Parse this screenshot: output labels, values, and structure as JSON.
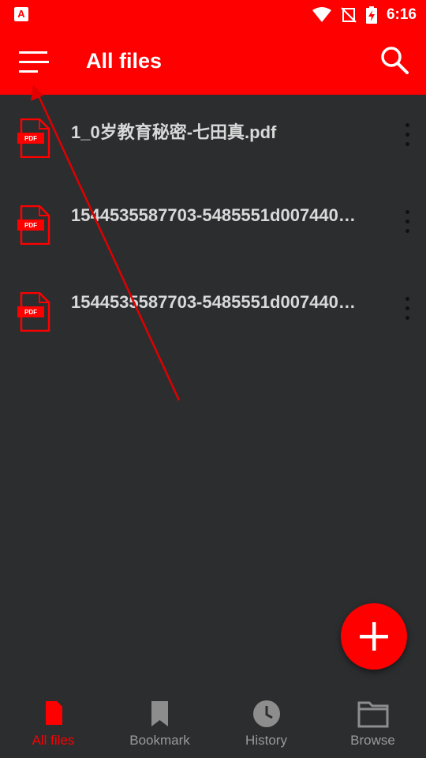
{
  "status_bar": {
    "time": "6:16",
    "app_icon_letter": "A"
  },
  "toolbar": {
    "title": "All files",
    "menu_icon": "menu-icon",
    "search_icon": "search-icon"
  },
  "files": [
    {
      "name": "1_0岁教育秘密-七田真.pdf",
      "icon_label": "PDF"
    },
    {
      "name": "1544535587703-5485551d007440…",
      "icon_label": "PDF"
    },
    {
      "name": "1544535587703-5485551d007440…",
      "icon_label": "PDF"
    }
  ],
  "bottom_nav": [
    {
      "label": "All files",
      "icon": "file-icon",
      "active": true
    },
    {
      "label": "Bookmark",
      "icon": "bookmark-icon",
      "active": false
    },
    {
      "label": "History",
      "icon": "clock-icon",
      "active": false
    },
    {
      "label": "Browse",
      "icon": "folder-icon",
      "active": false
    }
  ],
  "colors": {
    "accent": "#fe0000",
    "background": "#2c2d2f",
    "text": "#d9d9d9",
    "inactive": "#9a9a9a"
  }
}
